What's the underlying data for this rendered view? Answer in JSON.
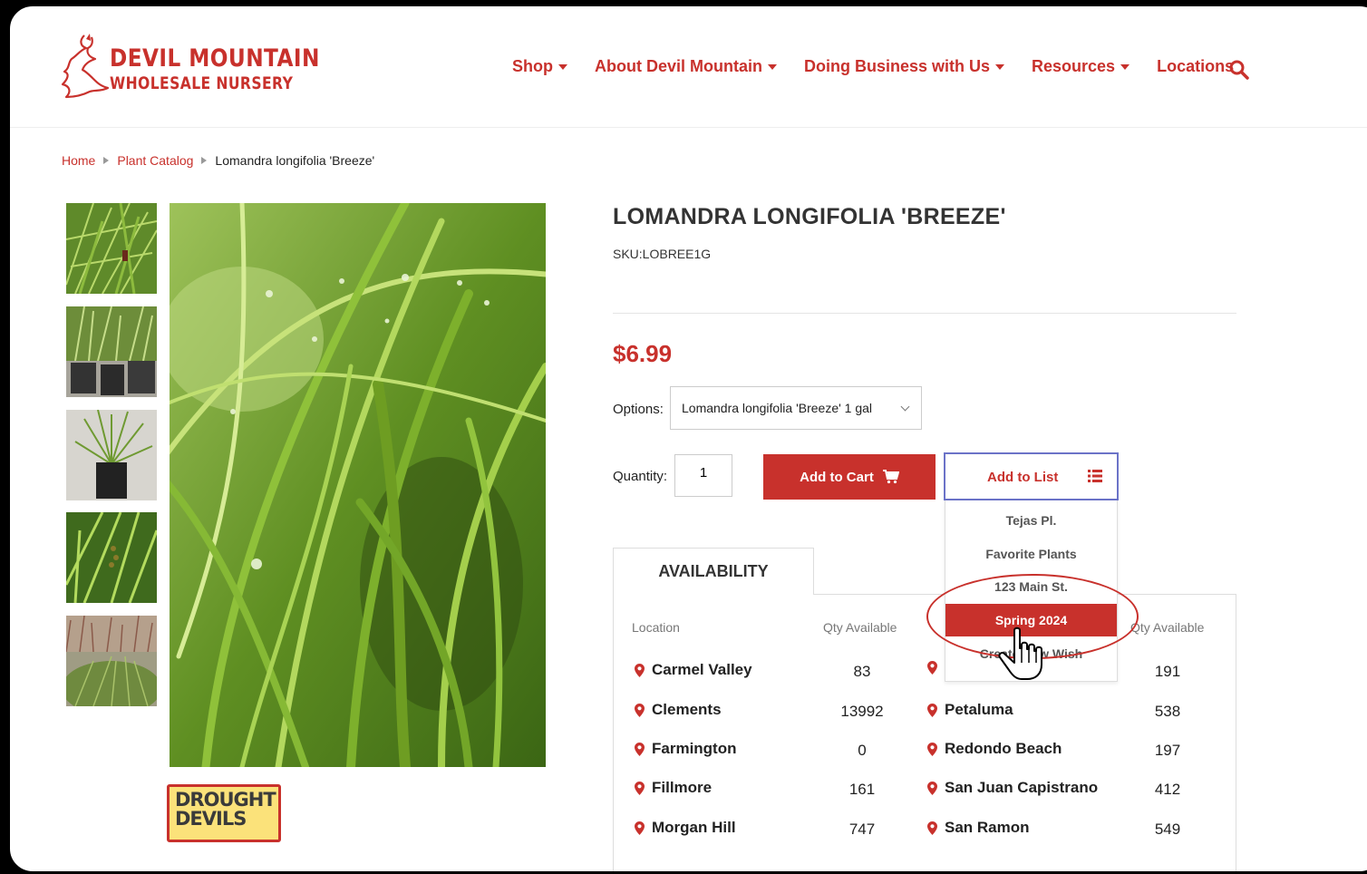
{
  "logo": {
    "line1": "DEVIL MOUNTAIN",
    "line2": "WHOLESALE NURSERY"
  },
  "nav": [
    {
      "label": "Shop",
      "has_dropdown": true
    },
    {
      "label": "About Devil Mountain",
      "has_dropdown": true
    },
    {
      "label": "Doing Business with Us",
      "has_dropdown": true
    },
    {
      "label": "Resources",
      "has_dropdown": true
    },
    {
      "label": "Locations",
      "has_dropdown": false
    }
  ],
  "breadcrumb": {
    "home": "Home",
    "catalog": "Plant Catalog",
    "current": "Lomandra longifolia 'Breeze'"
  },
  "product": {
    "title": "LOMANDRA LONGIFOLIA 'BREEZE'",
    "sku": "SKU:LOBREE1G",
    "price": "$6.99",
    "options_label": "Options:",
    "options_value": "Lomandra longifolia 'Breeze' 1 gal",
    "quantity_label": "Quantity:",
    "quantity_value": "1",
    "add_to_cart": "Add to Cart",
    "add_to_list": "Add to List"
  },
  "badge": {
    "line1": "DROUGHT",
    "line2": "DEVILS"
  },
  "list_dropdown": {
    "items": [
      "Tejas Pl.",
      "Favorite Plants",
      "123 Main St.",
      "Spring 2024",
      "Create New Wish"
    ],
    "selected": "Spring 2024"
  },
  "availability": {
    "tab_label": "AVAILABILITY",
    "col_location": "Location",
    "col_qty": "Qty Available",
    "left": [
      {
        "name": "Carmel Valley",
        "qty": "83"
      },
      {
        "name": "Clements",
        "qty": "13992"
      },
      {
        "name": "Farmington",
        "qty": "0"
      },
      {
        "name": "Fillmore",
        "qty": "161"
      },
      {
        "name": "Morgan Hill",
        "qty": "747"
      }
    ],
    "right": [
      {
        "name": "",
        "qty": "191"
      },
      {
        "name": "Petaluma",
        "qty": "538"
      },
      {
        "name": "Redondo Beach",
        "qty": "197"
      },
      {
        "name": "San Juan Capistrano",
        "qty": "412"
      },
      {
        "name": "San Ramon",
        "qty": "549"
      }
    ]
  },
  "colors": {
    "brand_red": "#c8312c",
    "focus_blue": "#6b73c8",
    "badge_yellow": "#fbe27a"
  }
}
